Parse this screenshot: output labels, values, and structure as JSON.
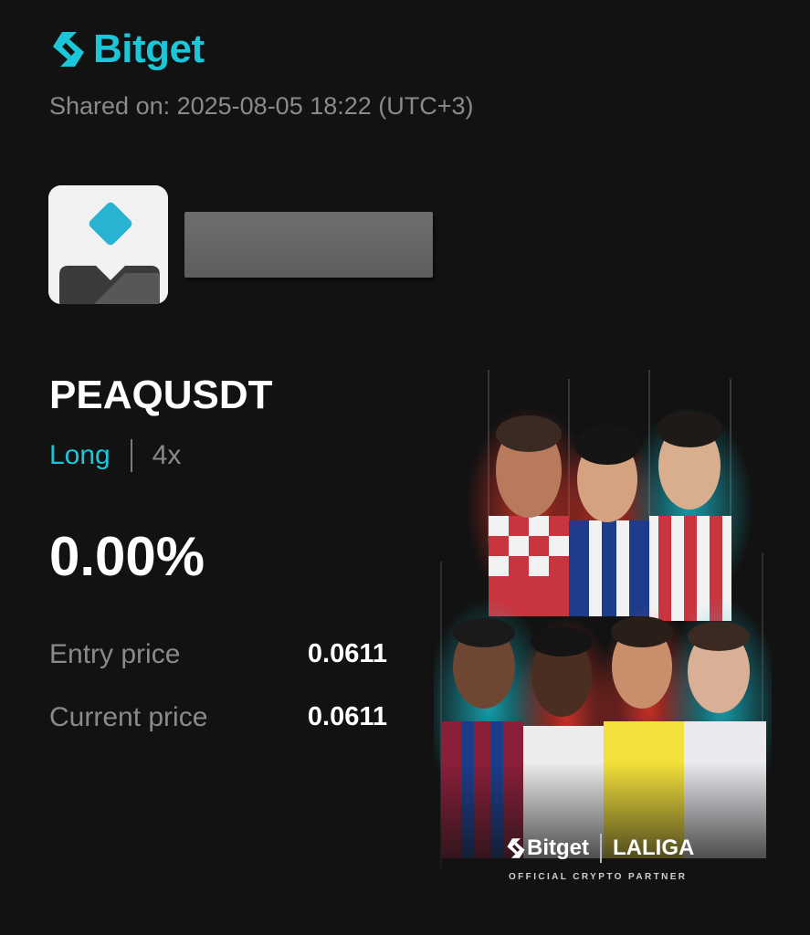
{
  "brand": {
    "name": "Bitget",
    "accent_color": "#1bc6d9",
    "icon": "bitget-logo-icon"
  },
  "shared_on": "Shared on: 2025-08-05 18:22 (UTC+3)",
  "user": {
    "avatar_icon": "default-avatar-icon",
    "name_redacted": true
  },
  "trade": {
    "pair": "PEAQUSDT",
    "side": "Long",
    "side_color": "#1bc6d9",
    "leverage": "4x",
    "pnl_percent": "0.00%",
    "entry_label": "Entry price",
    "entry_value": "0.0611",
    "current_label": "Current price",
    "current_value": "0.0611"
  },
  "promo": {
    "brand": "Bitget",
    "partner": "LALIGA",
    "tagline": "OFFICIAL CRYPTO PARTNER",
    "image": "laliga-players-artwork"
  }
}
